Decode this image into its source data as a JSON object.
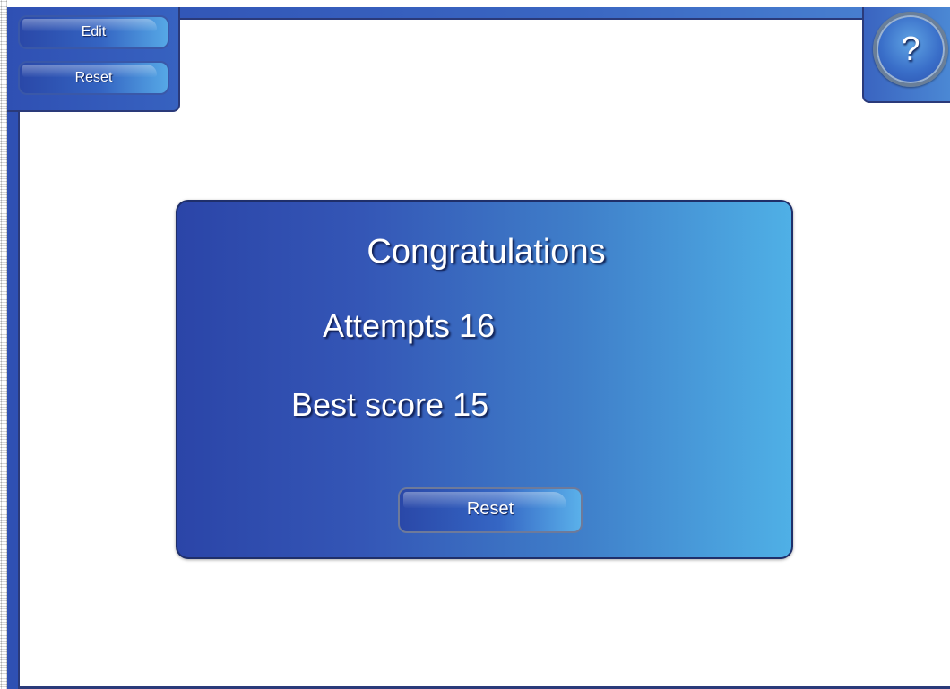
{
  "toolbar": {
    "edit_label": "Edit",
    "reset_label": "Reset"
  },
  "help": {
    "label": "?"
  },
  "result_dialog": {
    "title": "Congratulations",
    "attempts_text": "Attempts 16",
    "best_score_text": "Best score 15",
    "reset_label": "Reset"
  },
  "colors": {
    "panel_blue_dark": "#2b45a8",
    "panel_blue_light": "#4fb0e6",
    "border_dark": "#1f2f6a",
    "canvas_bg": "#ffffff"
  }
}
